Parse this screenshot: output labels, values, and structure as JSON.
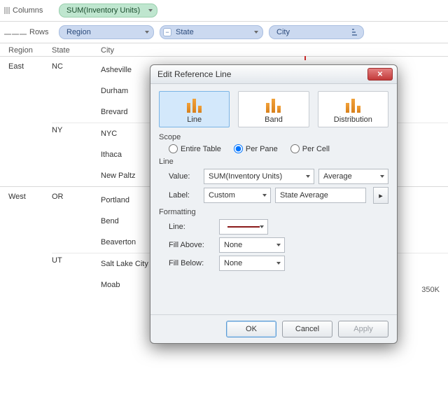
{
  "shelves": {
    "columns_label": "Columns",
    "columns_pill": "SUM(Inventory Units)",
    "rows_label": "Rows",
    "rows_pills": {
      "region": "Region",
      "state": "State",
      "city": "City"
    }
  },
  "headers": {
    "region": "Region",
    "state": "State",
    "city": "City"
  },
  "data_rows": [
    {
      "region": "East",
      "states": [
        {
          "state": "NC",
          "cities": [
            "Asheville",
            "Durham",
            "Brevard"
          ]
        },
        {
          "state": "NY",
          "cities": [
            "NYC",
            "Ithaca",
            "New Paltz"
          ]
        }
      ]
    },
    {
      "region": "West",
      "states": [
        {
          "state": "OR",
          "cities": [
            "Portland",
            "Bend",
            "Beaverton"
          ]
        },
        {
          "state": "UT",
          "cities": [
            "Salt Lake City",
            "Moab"
          ]
        }
      ]
    }
  ],
  "axis_tick": "350K",
  "dialog": {
    "title": "Edit Reference Line",
    "types": {
      "line": "Line",
      "band": "Band",
      "distribution": "Distribution"
    },
    "scope": {
      "title": "Scope",
      "entire": "Entire Table",
      "pane": "Per Pane",
      "cell": "Per Cell",
      "selected": "pane"
    },
    "line": {
      "title": "Line",
      "value_label": "Value:",
      "value_field": "SUM(Inventory Units)",
      "value_agg": "Average",
      "label_label": "Label:",
      "label_mode": "Custom",
      "label_text": "State Average"
    },
    "formatting": {
      "title": "Formatting",
      "line_label": "Line:",
      "fill_above_label": "Fill Above:",
      "fill_above_value": "None",
      "fill_below_label": "Fill Below:",
      "fill_below_value": "None"
    },
    "buttons": {
      "ok": "OK",
      "cancel": "Cancel",
      "apply": "Apply"
    }
  }
}
